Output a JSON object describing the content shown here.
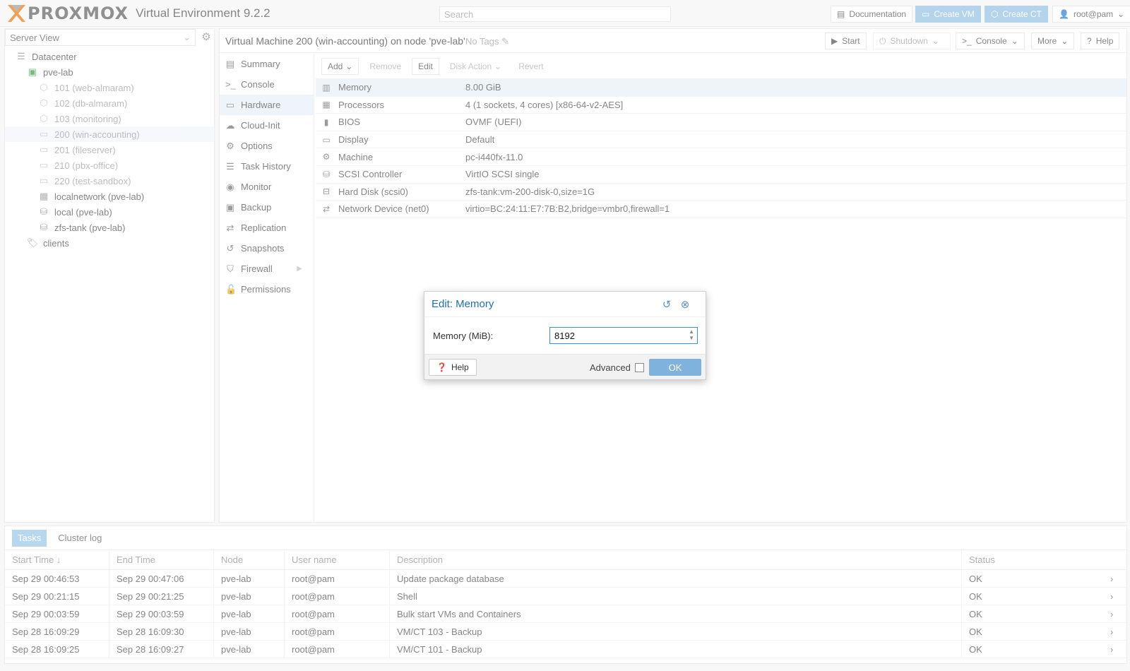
{
  "header": {
    "brand": "PROXMOX",
    "version": "Virtual Environment 9.2.2",
    "search_placeholder": "Search",
    "documentation": "Documentation",
    "create_vm": "Create VM",
    "create_ct": "Create CT",
    "user": "root@pam"
  },
  "sidebar": {
    "view": "Server View",
    "tree": [
      {
        "label": "Datacenter",
        "icon": "datacenter-icon"
      },
      {
        "label": "pve-lab",
        "icon": "node-icon"
      },
      {
        "label": "101 (web-almaram)",
        "icon": "container-icon"
      },
      {
        "label": "102 (db-almaram)",
        "icon": "container-icon"
      },
      {
        "label": "103 (monitoring)",
        "icon": "container-icon"
      },
      {
        "label": "200 (win-accounting)",
        "icon": "vm-icon"
      },
      {
        "label": "201 (fileserver)",
        "icon": "vm-icon"
      },
      {
        "label": "210 (pbx-office)",
        "icon": "vm-icon"
      },
      {
        "label": "220 (test-sandbox)",
        "icon": "vm-icon"
      },
      {
        "label": "localnetwork (pve-lab)",
        "icon": "network-icon"
      },
      {
        "label": "local (pve-lab)",
        "icon": "storage-icon"
      },
      {
        "label": "zfs-tank (pve-lab)",
        "icon": "storage-icon"
      },
      {
        "label": "clients",
        "icon": "tag-icon"
      }
    ]
  },
  "vm_header": {
    "title": "Virtual Machine 200 (win-accounting) on node 'pve-lab'",
    "tags": "No Tags",
    "start": "Start",
    "shutdown": "Shutdown",
    "console": "Console",
    "more": "More",
    "help": "Help"
  },
  "vm_nav": [
    "Summary",
    "Console",
    "Hardware",
    "Cloud-Init",
    "Options",
    "Task History",
    "Monitor",
    "Backup",
    "Replication",
    "Snapshots",
    "Firewall",
    "Permissions"
  ],
  "hardware_toolbar": {
    "add": "Add",
    "remove": "Remove",
    "edit": "Edit",
    "disk_action": "Disk Action",
    "revert": "Revert"
  },
  "hardware": [
    {
      "name": "Memory",
      "value": "8.00 GiB",
      "icon": "memory-icon"
    },
    {
      "name": "Processors",
      "value": "4 (1 sockets, 4 cores) [x86-64-v2-AES]",
      "icon": "cpu-icon"
    },
    {
      "name": "BIOS",
      "value": "OVMF (UEFI)",
      "icon": "bios-icon"
    },
    {
      "name": "Display",
      "value": "Default",
      "icon": "display-icon"
    },
    {
      "name": "Machine",
      "value": "pc-i440fx-11.0",
      "icon": "machine-icon"
    },
    {
      "name": "SCSI Controller",
      "value": "VirtIO SCSI single",
      "icon": "scsi-icon"
    },
    {
      "name": "Hard Disk (scsi0)",
      "value": "zfs-tank:vm-200-disk-0,size=1G",
      "icon": "disk-icon"
    },
    {
      "name": "Network Device (net0)",
      "value": "virtio=BC:24:11:E7:7B:B2,bridge=vmbr0,firewall=1",
      "icon": "network-icon"
    }
  ],
  "tasks": {
    "tabs": [
      "Tasks",
      "Cluster log"
    ],
    "columns": [
      "Start Time ↓",
      "End Time",
      "Node",
      "User name",
      "Description",
      "Status"
    ],
    "rows": [
      [
        "Sep 29 00:46:53",
        "Sep 29 00:47:06",
        "pve-lab",
        "root@pam",
        "Update package database",
        "OK"
      ],
      [
        "Sep 29 00:21:15",
        "Sep 29 00:21:25",
        "pve-lab",
        "root@pam",
        "Shell",
        "OK"
      ],
      [
        "Sep 29 00:03:59",
        "Sep 29 00:03:59",
        "pve-lab",
        "root@pam",
        "Bulk start VMs and Containers",
        "OK"
      ],
      [
        "Sep 28 16:09:29",
        "Sep 28 16:09:30",
        "pve-lab",
        "root@pam",
        "VM/CT 103 - Backup",
        "OK"
      ],
      [
        "Sep 28 16:09:25",
        "Sep 28 16:09:27",
        "pve-lab",
        "root@pam",
        "VM/CT 101 - Backup",
        "OK"
      ]
    ]
  },
  "dialog": {
    "title": "Edit: Memory",
    "field_label": "Memory (MiB):",
    "field_value": "8192",
    "help": "Help",
    "advanced": "Advanced",
    "ok": "OK"
  },
  "colors": {
    "accent": "#3892d4",
    "brand_orange": "#e57000",
    "selection": "#e6eef7"
  }
}
